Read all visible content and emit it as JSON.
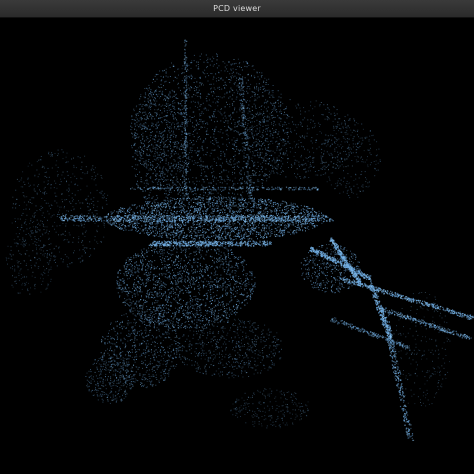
{
  "window": {
    "title": "PCD viewer"
  },
  "viewer": {
    "background_color": "#000000",
    "point_color": "#6aa8e0",
    "point_highlight_color": "#8ec7f2"
  }
}
